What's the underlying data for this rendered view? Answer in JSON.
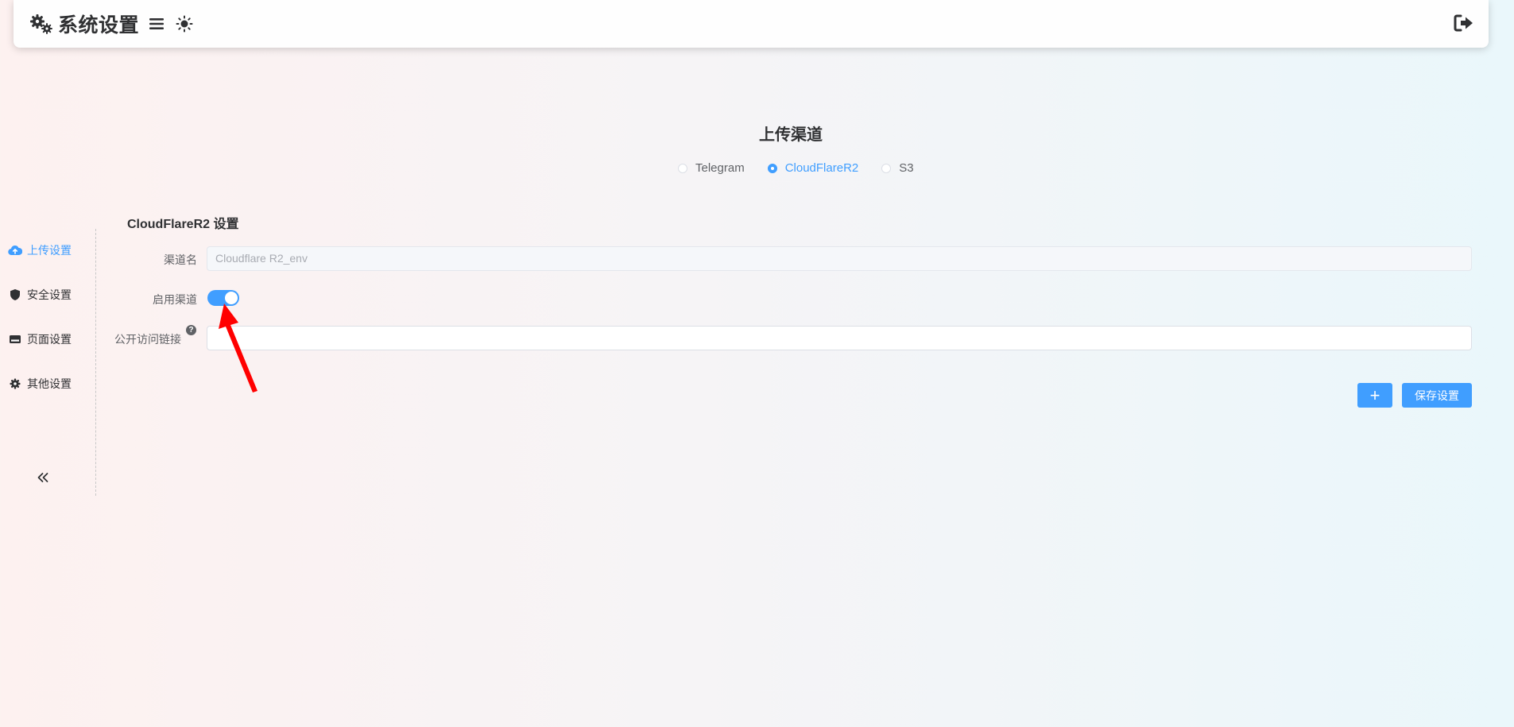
{
  "header": {
    "title": "系统设置"
  },
  "upload_channel": {
    "title": "上传渠道",
    "options": [
      {
        "label": "Telegram",
        "selected": false
      },
      {
        "label": "CloudFlareR2",
        "selected": true
      },
      {
        "label": "S3",
        "selected": false
      }
    ]
  },
  "sidebar": {
    "items": [
      {
        "label": "上传设置",
        "icon": "cloud-upload-icon",
        "active": true
      },
      {
        "label": "安全设置",
        "icon": "shield-icon",
        "active": false
      },
      {
        "label": "页面设置",
        "icon": "page-icon",
        "active": false
      },
      {
        "label": "其他设置",
        "icon": "gear-icon",
        "active": false
      }
    ]
  },
  "form": {
    "section_title": "CloudFlareR2 设置",
    "channel_name_label": "渠道名",
    "channel_name_value": "Cloudflare R2_env",
    "enable_label": "启用渠道",
    "enable_value": true,
    "public_url_label": "公开访问链接",
    "public_url_value": "",
    "help_glyph": "?"
  },
  "buttons": {
    "add_label": "+",
    "save_label": "保存设置"
  },
  "colors": {
    "accent": "#409eff",
    "annotation_arrow": "#ff0000"
  }
}
